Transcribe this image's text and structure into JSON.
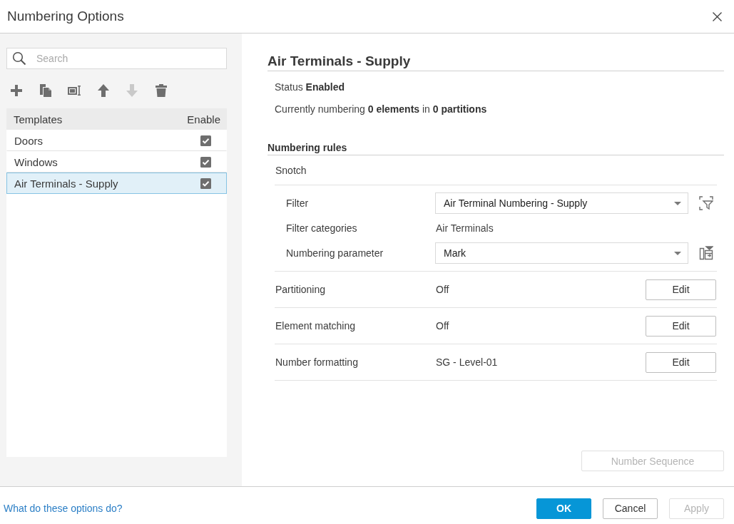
{
  "window": {
    "title": "Numbering Options"
  },
  "sidebar": {
    "search": {
      "placeholder": "Search"
    },
    "toolbar": [
      {
        "kind": "add",
        "disabled": false
      },
      {
        "kind": "copy",
        "disabled": false
      },
      {
        "kind": "rename",
        "disabled": false
      },
      {
        "kind": "move_up",
        "disabled": false
      },
      {
        "kind": "move_down",
        "disabled": true
      },
      {
        "kind": "delete",
        "disabled": false
      }
    ],
    "table": {
      "columns": [
        "Templates",
        "Enable"
      ],
      "rows": [
        {
          "name": "Doors",
          "checked": true,
          "selected": false
        },
        {
          "name": "Windows",
          "checked": true,
          "selected": false
        },
        {
          "name": "Air Terminals - Supply",
          "checked": true,
          "selected": true
        }
      ]
    }
  },
  "detail": {
    "title": "Air Terminals - Supply",
    "status": "Status **Enabled**",
    "summary": "Currently numbering **0 elements** in **0 partitions**",
    "rules": {
      "heading": "Numbering rules",
      "name": "Snotch",
      "fields": [
        {
          "kind": "filter",
          "label": "Filter",
          "value": "Air Terminal Numbering - Supply"
        },
        {
          "kind": "categories",
          "label": "Filter categories",
          "value": "Air Terminals"
        },
        {
          "kind": "parameter",
          "label": "Numbering parameter",
          "value": "Mark"
        }
      ],
      "settings": [
        {
          "label": "Partitioning",
          "value": "Off",
          "button": "Edit"
        },
        {
          "label": "Element matching",
          "value": "Off",
          "button": "Edit"
        },
        {
          "label": "Number formatting",
          "value": "SG - Level-01",
          "button": "Edit"
        }
      ]
    },
    "sequence_button": {
      "label": "Number Sequence",
      "disabled": true
    }
  },
  "footer": {
    "help_link": "What do these options do?",
    "buttons": [
      {
        "label": "OK",
        "kind": "primary",
        "disabled": false
      },
      {
        "label": "Cancel",
        "kind": "secondary",
        "disabled": false
      },
      {
        "label": "Apply",
        "kind": "secondary",
        "disabled": true
      }
    ]
  }
}
